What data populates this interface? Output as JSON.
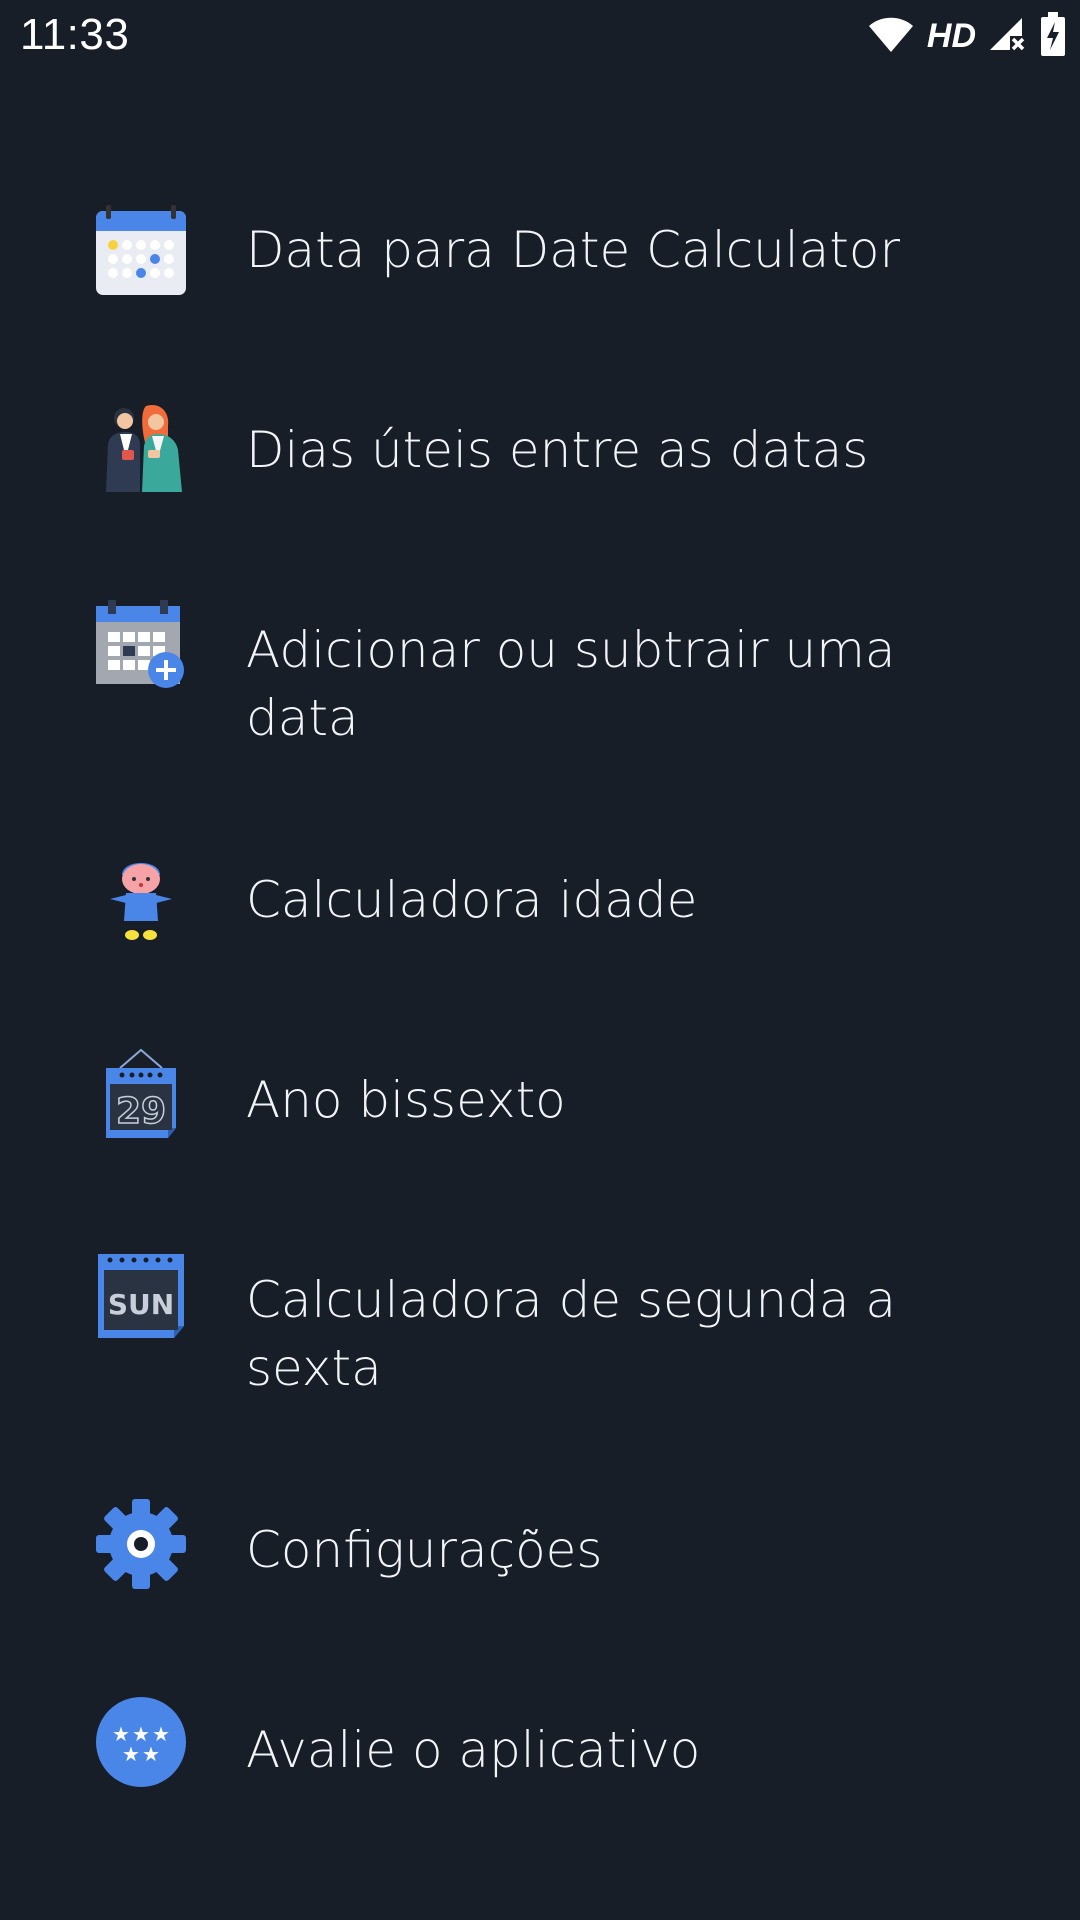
{
  "status_bar": {
    "time": "11:33",
    "network_label": "HD",
    "icons": [
      "wifi-icon",
      "cell-signal-icon",
      "battery-charging-icon"
    ]
  },
  "menu": {
    "items": [
      {
        "label": "Data para Date Calculator",
        "icon": "calendar-grid-icon"
      },
      {
        "label": "Dias úteis entre as datas",
        "icon": "business-people-icon"
      },
      {
        "label": "Adicionar ou subtrair uma data",
        "icon": "calendar-add-icon"
      },
      {
        "label": "Calculadora idade",
        "icon": "child-figure-icon"
      },
      {
        "label": "Ano bissexto",
        "icon": "calendar-29-icon"
      },
      {
        "label": "Calculadora de segunda a sexta",
        "icon": "calendar-sun-icon"
      },
      {
        "label": "Configurações",
        "icon": "gear-icon"
      },
      {
        "label": "Avalie o aplicativo",
        "icon": "rating-stars-icon"
      }
    ]
  },
  "colors": {
    "background": "#171e28",
    "accent_blue": "#4a86e8",
    "text": "#f2f4f7"
  }
}
